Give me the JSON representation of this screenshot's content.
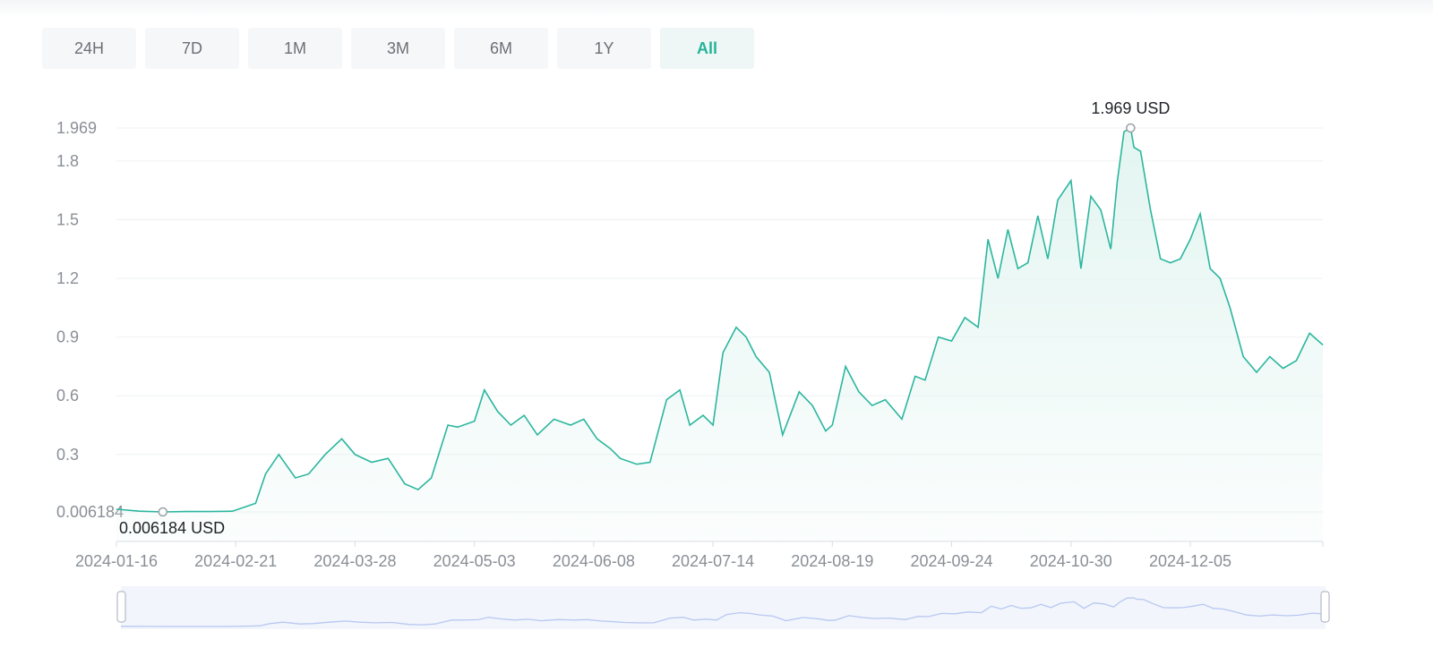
{
  "range_selector": {
    "options": [
      "24H",
      "7D",
      "1M",
      "3M",
      "6M",
      "1Y",
      "All"
    ],
    "active": "All"
  },
  "colors": {
    "line": "#2bb69e",
    "fill": "#e3f5f1",
    "navigator_line": "#b7c8f0",
    "navigator_bg": "#f2f5fc"
  },
  "chart_data": {
    "type": "area",
    "title": "",
    "xlabel": "",
    "ylabel": "",
    "unit": "USD",
    "x_ticks": [
      "2024-01-16",
      "2024-02-21",
      "2024-03-28",
      "2024-05-03",
      "2024-06-08",
      "2024-07-14",
      "2024-08-19",
      "2024-09-24",
      "2024-10-30",
      "2024-12-05"
    ],
    "y_ticks": [
      "0.006184",
      "0.3",
      "0.6",
      "0.9",
      "1.2",
      "1.5",
      "1.8",
      "1.969"
    ],
    "ylim": [
      0.006184,
      1.969
    ],
    "xlim": [
      "2024-01-16",
      "2025-01-14"
    ],
    "max_annotation": {
      "date": "2024-11-17",
      "value": 1.969,
      "label": "1.969 USD"
    },
    "min_annotation": {
      "date": "2024-01-30",
      "value": 0.006184,
      "label": "0.006184 USD"
    },
    "grid": true,
    "series": [
      {
        "x": [
          "2024-01-16",
          "2024-01-23",
          "2024-01-30",
          "2024-02-06",
          "2024-02-13",
          "2024-02-20",
          "2024-02-27",
          "2024-03-01",
          "2024-03-05",
          "2024-03-10",
          "2024-03-14",
          "2024-03-19",
          "2024-03-24",
          "2024-03-28",
          "2024-04-02",
          "2024-04-07",
          "2024-04-12",
          "2024-04-16",
          "2024-04-20",
          "2024-04-25",
          "2024-04-28",
          "2024-05-03",
          "2024-05-06",
          "2024-05-10",
          "2024-05-14",
          "2024-05-18",
          "2024-05-22",
          "2024-05-27",
          "2024-06-01",
          "2024-06-05",
          "2024-06-09",
          "2024-06-13",
          "2024-06-16",
          "2024-06-21",
          "2024-06-25",
          "2024-06-30",
          "2024-07-04",
          "2024-07-07",
          "2024-07-11",
          "2024-07-14",
          "2024-07-17",
          "2024-07-21",
          "2024-07-24",
          "2024-07-27",
          "2024-07-31",
          "2024-08-04",
          "2024-08-09",
          "2024-08-13",
          "2024-08-17",
          "2024-08-19",
          "2024-08-23",
          "2024-08-27",
          "2024-08-31",
          "2024-09-04",
          "2024-09-09",
          "2024-09-13",
          "2024-09-16",
          "2024-09-20",
          "2024-09-24",
          "2024-09-28",
          "2024-10-02",
          "2024-10-05",
          "2024-10-08",
          "2024-10-11",
          "2024-10-14",
          "2024-10-17",
          "2024-10-20",
          "2024-10-23",
          "2024-10-26",
          "2024-10-30",
          "2024-11-02",
          "2024-11-05",
          "2024-11-08",
          "2024-11-11",
          "2024-11-13",
          "2024-11-15",
          "2024-11-17",
          "2024-11-18",
          "2024-11-20",
          "2024-11-23",
          "2024-11-26",
          "2024-11-29",
          "2024-12-02",
          "2024-12-05",
          "2024-12-08",
          "2024-12-11",
          "2024-12-14",
          "2024-12-17",
          "2024-12-21",
          "2024-12-25",
          "2024-12-29",
          "2025-01-02",
          "2025-01-06",
          "2025-01-10",
          "2025-01-14"
        ],
        "values": [
          0.02,
          0.01,
          0.006184,
          0.008,
          0.008,
          0.01,
          0.05,
          0.2,
          0.3,
          0.18,
          0.2,
          0.3,
          0.38,
          0.3,
          0.26,
          0.28,
          0.15,
          0.12,
          0.18,
          0.45,
          0.44,
          0.47,
          0.63,
          0.52,
          0.45,
          0.5,
          0.4,
          0.48,
          0.45,
          0.48,
          0.38,
          0.33,
          0.28,
          0.25,
          0.26,
          0.58,
          0.63,
          0.45,
          0.5,
          0.45,
          0.82,
          0.95,
          0.9,
          0.8,
          0.72,
          0.4,
          0.62,
          0.55,
          0.42,
          0.45,
          0.75,
          0.62,
          0.55,
          0.58,
          0.48,
          0.7,
          0.68,
          0.9,
          0.88,
          1.0,
          0.95,
          1.4,
          1.2,
          1.45,
          1.25,
          1.28,
          1.52,
          1.3,
          1.6,
          1.7,
          1.25,
          1.62,
          1.55,
          1.35,
          1.7,
          1.95,
          1.969,
          1.87,
          1.85,
          1.55,
          1.3,
          1.28,
          1.3,
          1.4,
          1.53,
          1.25,
          1.2,
          1.05,
          0.8,
          0.72,
          0.8,
          0.74,
          0.78,
          0.92,
          0.86
        ]
      }
    ]
  }
}
